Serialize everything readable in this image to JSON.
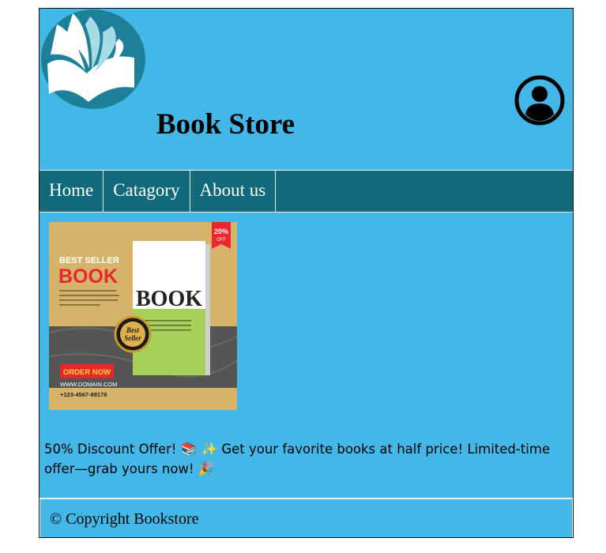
{
  "header": {
    "title": "Book Store",
    "logo_icon": "open-book-logo-icon",
    "user_icon": "user-account-icon"
  },
  "nav": {
    "items": [
      {
        "label": "Home"
      },
      {
        "label": "Catagory"
      },
      {
        "label": "About us"
      }
    ]
  },
  "promo": {
    "badge": "20%",
    "badge_sub": "OFF",
    "tagline_top": "BEST SELLER",
    "tagline_main": "BOOK",
    "seal_line1": "Best",
    "seal_line2": "Seller",
    "cover_title": "BOOK",
    "cta": "ORDER NOW",
    "domain": "WWW.DOMAIN.COM",
    "phone": "+123-4567-89178"
  },
  "offer": {
    "text": "50% Discount Offer! 📚 ✨ Get your favorite books at half price! Limited-time offer—grab yours now! 🎉"
  },
  "footer": {
    "text": "© Copyright Bookstore"
  },
  "colors": {
    "background": "#43b7e8",
    "nav": "#106a7b",
    "logo": "#1e7f99"
  }
}
